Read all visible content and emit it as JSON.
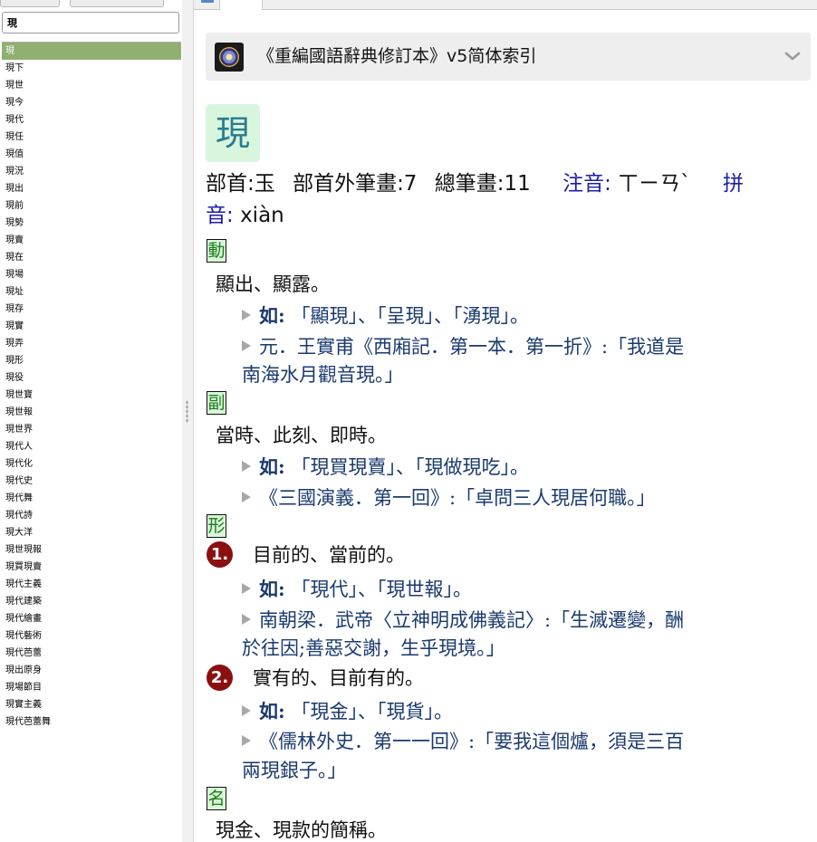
{
  "sidebar": {
    "search_value": "現",
    "words": [
      "現",
      "現下",
      "現世",
      "現今",
      "現代",
      "現任",
      "現值",
      "現況",
      "現出",
      "現前",
      "現勢",
      "現賣",
      "現在",
      "現場",
      "現址",
      "現存",
      "現實",
      "現弄",
      "現形",
      "現役",
      "現世寶",
      "現世報",
      "現世界",
      "現代人",
      "現代化",
      "現代史",
      "現代舞",
      "現代詩",
      "現大洋",
      "現世現報",
      "現買現賣",
      "現代主義",
      "現代建築",
      "現代繪畫",
      "現代藝術",
      "現代芭蕾",
      "現出原身",
      "現場節目",
      "現實主義",
      "現代芭蕾舞"
    ],
    "selected_index": 0
  },
  "dictionary": {
    "title": "《重編國語辭典修訂本》v5简体索引",
    "logo_icon": "dictionary-logo-icon",
    "collapse_icon": "chevron-down-icon"
  },
  "entry": {
    "headword": "現",
    "radical": "部首:玉",
    "strokes_outside": "部首外筆畫:7",
    "total_strokes": "總筆畫:11",
    "zhuyin_label": "注音:",
    "zhuyin": "ㄒㄧㄢˋ",
    "pinyin_label_a": "拼",
    "pinyin_label_b": "音:",
    "pinyin": "xiàn",
    "pos_verb": "動",
    "verb_def": "顯出、顯露。",
    "verb_ex1_label": "如:",
    "verb_ex1_text": "「顯現」、「呈現」、「湧現」。",
    "verb_ex2_line1": "元．王實甫《西廂記．第一本．第一折》:「我道是",
    "verb_ex2_line2": "南海水月觀音現。」",
    "pos_adverb": "副",
    "adverb_def": "當時、此刻、即時。",
    "adverb_ex1_label": "如:",
    "adverb_ex1_text": "「現買現賣」、「現做現吃」。",
    "adverb_ex2": "《三國演義．第一回》:「卓問三人現居何職。」",
    "pos_adjective": "形",
    "sense1_num": "1.",
    "sense1_def": "目前的、當前的。",
    "sense1_ex1_label": "如:",
    "sense1_ex1_text": "「現代」、「現世報」。",
    "sense1_ex2_line1": "南朝梁．武帝〈立神明成佛義記〉:「生滅遷變，酬",
    "sense1_ex2_line2": "於往因;善惡交謝，生乎現境。」",
    "sense2_num": "2.",
    "sense2_def": "實有的、目前有的。",
    "sense2_ex1_label": "如:",
    "sense2_ex1_text": "「現金」、「現貨」。",
    "sense2_ex2_line1": "《儒林外史．第一一回》:「要我這個爐，須是三百",
    "sense2_ex2_line2": "兩現銀子。」",
    "pos_noun": "名",
    "noun_def": "現金、現款的簡稱。"
  },
  "colors": {
    "selected_row": "#8fb070",
    "zhuyin_label": "#1d1da8",
    "example_text": "#1a3a6e",
    "sense_badge": "#8b0f0f",
    "pos_tag_bg": "#d9f8d9",
    "headword_bg": "#d8f6dd"
  }
}
